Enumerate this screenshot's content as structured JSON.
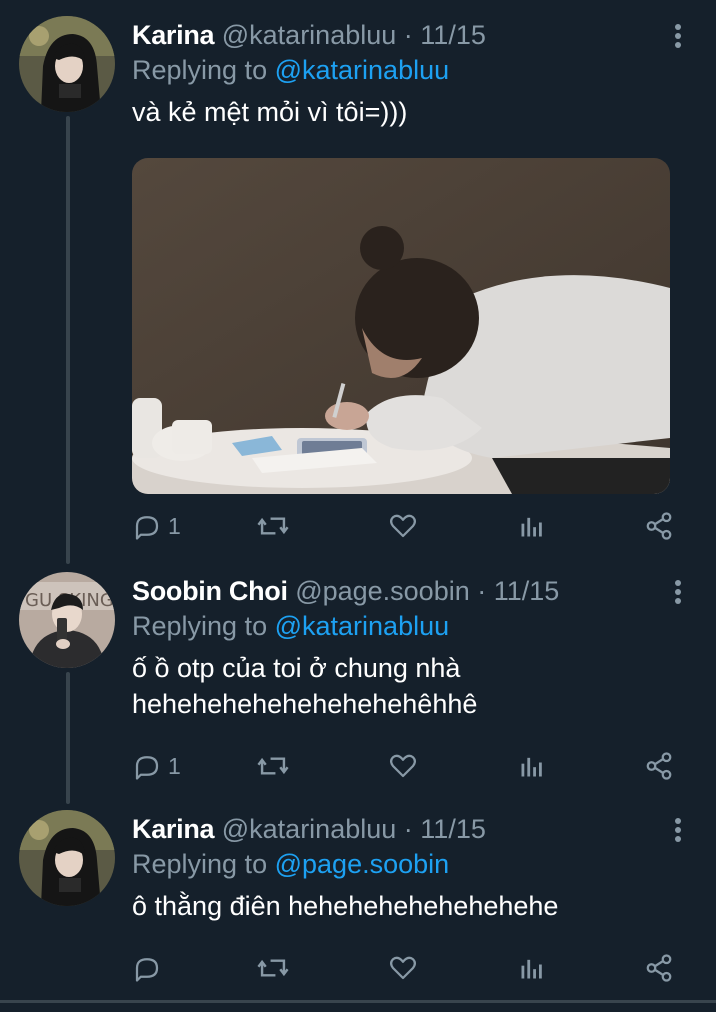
{
  "tweets": [
    {
      "name": "Karina",
      "handle": "@katarinabluu",
      "separator": "·",
      "date": "11/15",
      "replying_prefix": "Replying to",
      "replying_to": "@katarinabluu",
      "text": "và kẻ mệt mỏi vì tôi=)))",
      "has_media": true,
      "actions": {
        "reply_count": "1",
        "retweet_count": "",
        "like_count": ""
      }
    },
    {
      "name": "Soobin Choi",
      "handle": "@page.soobin",
      "separator": "·",
      "date": "11/15",
      "replying_prefix": "Replying to",
      "replying_to": "@katarinabluu",
      "text_lines": [
        "ố ồ otp của toi ở chung nhà",
        "hehehehehehehehehehêhhê"
      ],
      "has_media": false,
      "actions": {
        "reply_count": "1",
        "retweet_count": "",
        "like_count": ""
      }
    },
    {
      "name": "Karina",
      "handle": "@katarinabluu",
      "separator": "·",
      "date": "11/15",
      "replying_prefix": "Replying to",
      "replying_to": "@page.soobin",
      "text": "ô thằng điên hehehehehehehehehe",
      "has_media": false,
      "actions": {
        "reply_count": "",
        "retweet_count": "",
        "like_count": ""
      }
    }
  ],
  "icons": {
    "reply": "reply-icon",
    "retweet": "retweet-icon",
    "like": "heart-icon",
    "analytics": "analytics-icon",
    "share": "share-icon",
    "more": "more-options-icon"
  },
  "colors": {
    "background": "#15202b",
    "text_primary": "#ffffff",
    "text_secondary": "#8899a6",
    "link": "#1da1f2",
    "divider": "#38444d"
  }
}
